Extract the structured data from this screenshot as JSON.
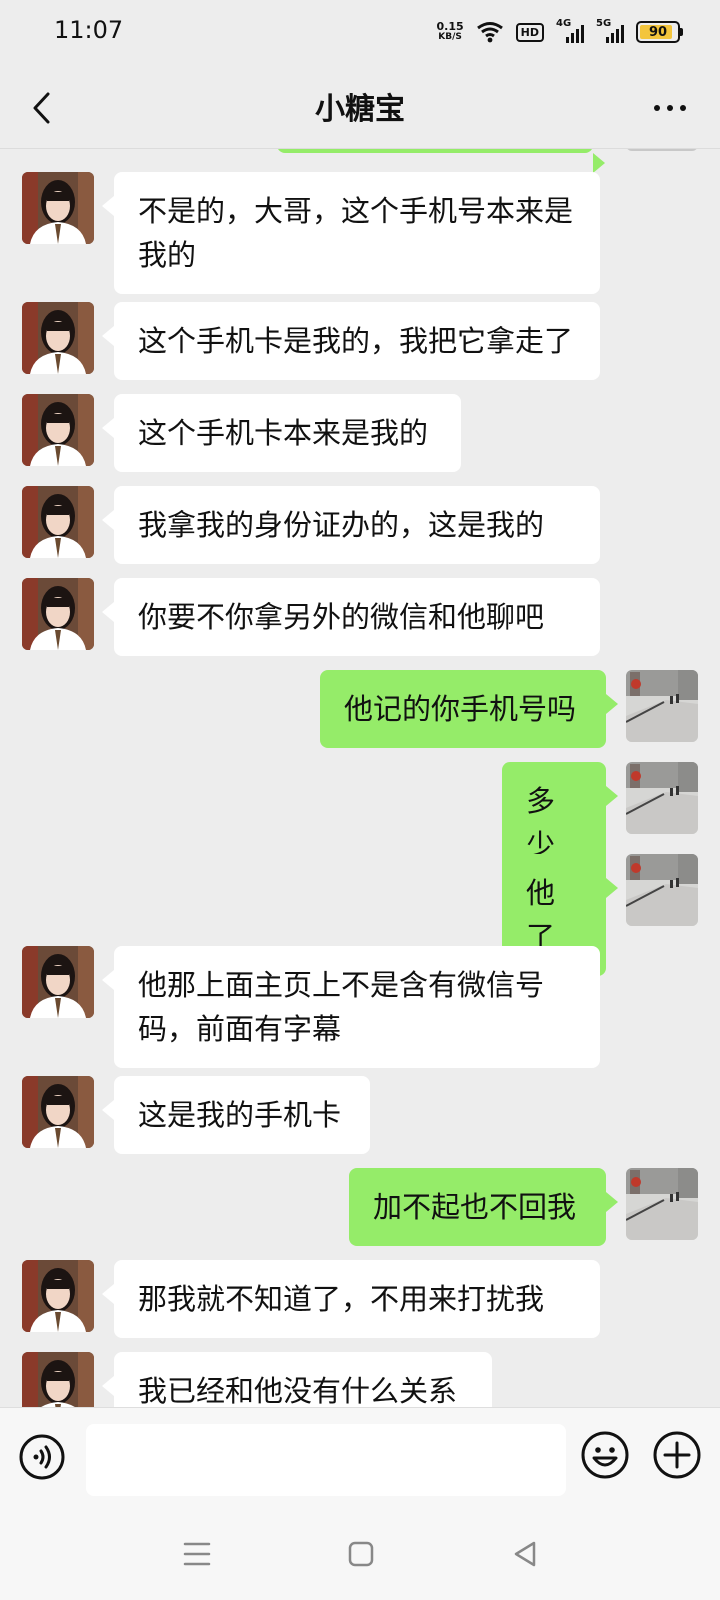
{
  "status_bar": {
    "time": "11:07",
    "net_speed_value": "0.15",
    "net_speed_unit": "KB/S",
    "hd_label": "HD",
    "sim1_label": "4G",
    "sim2_label": "5G",
    "battery_percent": "90"
  },
  "header": {
    "title": "小糖宝",
    "back_icon": "chevron-left-icon",
    "more_icon": "more-dots-icon"
  },
  "colors": {
    "background": "#ededed",
    "outgoing_bubble": "#95ec69",
    "incoming_bubble": "#ffffff",
    "battery_fill": "#f3c53d"
  },
  "messages": [
    {
      "side": "in",
      "text": "不是的，大哥，这个手机号本来是我的"
    },
    {
      "side": "in",
      "text": "这个手机卡是我的，我把它拿走了"
    },
    {
      "side": "in",
      "text": "这个手机卡本来是我的"
    },
    {
      "side": "in",
      "text": "我拿我的身份证办的，这是我的"
    },
    {
      "side": "in",
      "text": "你要不你拿另外的微信和他聊吧"
    },
    {
      "side": "out",
      "text": "他记的你手机号吗"
    },
    {
      "side": "out",
      "text": "多少"
    },
    {
      "side": "out",
      "text": "他了"
    },
    {
      "side": "in",
      "text": "他那上面主页上不是含有微信号码，前面有字幕"
    },
    {
      "side": "in",
      "text": "这是我的手机卡"
    },
    {
      "side": "out",
      "text": "加不起也不回我"
    },
    {
      "side": "in",
      "text": "那我就不知道了，不用来打扰我"
    },
    {
      "side": "in",
      "text": "我已经和他没有什么关系"
    }
  ],
  "input_bar": {
    "voice_icon": "voice-icon",
    "text_value": "",
    "emoji_icon": "emoji-icon",
    "plus_icon": "plus-icon"
  },
  "nav_bar": {
    "menu_icon": "menu-icon",
    "home_icon": "home-square-icon",
    "back_icon": "back-triangle-icon"
  }
}
